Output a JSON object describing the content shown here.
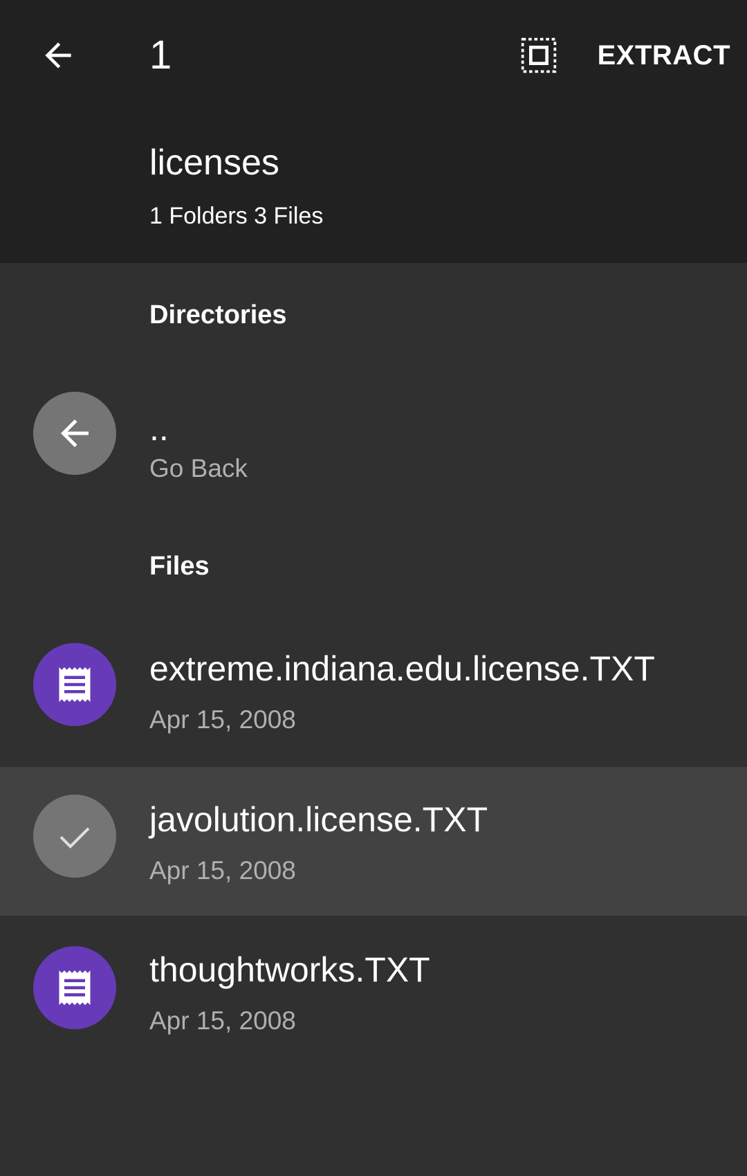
{
  "toolbar": {
    "selection_count": "1",
    "extract_label": "EXTRACT",
    "icons": {
      "back": "arrow-back-icon",
      "select_all": "select-all-icon"
    }
  },
  "archive": {
    "name": "licenses",
    "summary": "1 Folders 3 Files"
  },
  "sections": {
    "directories": "Directories",
    "files": "Files"
  },
  "directories": [
    {
      "name": "..",
      "subtitle": "Go Back",
      "icon": "arrow-back-icon"
    }
  ],
  "files": [
    {
      "name": "extreme.indiana.edu.license.TXT",
      "date": "Apr 15, 2008",
      "selected": false,
      "icon": "text-file-icon"
    },
    {
      "name": "javolution.license.TXT",
      "date": "Apr 15, 2008",
      "selected": true,
      "icon": "check-icon"
    },
    {
      "name": "thoughtworks.TXT",
      "date": "Apr 15, 2008",
      "selected": false,
      "icon": "text-file-icon"
    }
  ],
  "colors": {
    "appbar": "#212121",
    "background": "#303030",
    "selected_row": "#424242",
    "file_avatar": "#673AB7",
    "grey_avatar": "#757575",
    "secondary_text": "#b0b0b0"
  }
}
